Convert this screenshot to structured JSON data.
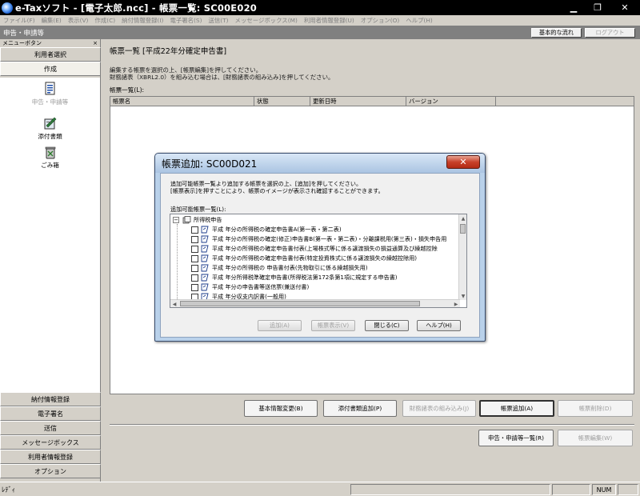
{
  "window": {
    "title": "e-Taxソフト - [電子太郎.ncc] - 帳票一覧: SC00E020",
    "minimize": "▁",
    "restore": "❐",
    "close": "✕"
  },
  "menubar": {
    "items": [
      "ファイル(F)",
      "編集(E)",
      "表示(V)",
      "作成(C)",
      "納付情報登録(I)",
      "電子署名(S)",
      "送信(T)",
      "メッセージボックス(M)",
      "利用者情報登録(U)",
      "オプション(O)",
      "ヘルプ(H)"
    ]
  },
  "section": {
    "title": "申告・申請等",
    "basic_flow_button": "基本的な流れ",
    "logout_button": "ログアウト"
  },
  "left_panel": {
    "header": "メニューボタン",
    "pin": "×",
    "user_select": "利用者選択",
    "create": "作成",
    "items": [
      {
        "label": "申告・申請等",
        "icon": "document-form-icon"
      },
      {
        "label": "添付書類",
        "icon": "attachment-icon"
      },
      {
        "label": "ごみ箱",
        "icon": "trash-icon"
      }
    ],
    "bottom_buttons": [
      "納付情報登録",
      "電子署名",
      "送信",
      "メッセージボックス",
      "利用者情報登録",
      "オプション"
    ]
  },
  "main": {
    "heading": "帳票一覧 [平成22年分確定申告書]",
    "instructions": [
      "編集する帳票を選択の上、[帳票編集]を押してください。",
      "財務諸表（XBRL2.0）を組み込む場合は、[財務諸表の組み込み]を押してください。"
    ],
    "list_label": "帳票一覧(L):",
    "columns": [
      "帳票名",
      "状態",
      "更新日時",
      "バージョン"
    ],
    "buttons": {
      "basic_info_change": "基本情報変更(B)",
      "add_attachment": "添付書類追加(P)",
      "import_financial": "財務諸表の組み込み(J)",
      "add_form": "帳票追加(A)",
      "delete_form": "帳票削除(D)",
      "declaration_list": "申告・申請等一覧(R)",
      "edit_form": "帳票編集(W)"
    }
  },
  "dialog": {
    "title": "帳票追加: SC00D021",
    "close": "✕",
    "instructions": [
      "追加可能帳票一覧より追加する帳票を選択の上、[追加]を押してください。",
      "[帳票表示]を押すことにより、帳票のイメージが表示され確認することができます。"
    ],
    "list_label": "追加可能帳票一覧(L):",
    "root": {
      "expander": "⊟",
      "label": "所得税申告"
    },
    "rows": [
      "平成  年分の所得税の確定申告書A(第一表・第二表)",
      "平成  年分の所得税の確定(修正)申告書B(第一表・第二表)・分離課税用(第三表)・損失申告用",
      "平成  年分の所得税の確定申告書付表(上場株式等に係る譲渡損失の損益通算及び繰越控除",
      "平成  年分の所得税の確定申告書付表(特定投資株式に係る譲渡損失の繰越控除用)",
      "平成  年分の所得税の    申告書付表(先物取引に係る繰越損失用)",
      "平成  年分所得税準確定申告書(所得税法第172条第1項に規定する申告書)",
      "平成  年分の申告書等送信票(兼送付書)",
      "平成  年分収支内訳書(一般用)"
    ],
    "buttons": {
      "add": "追加(A)",
      "show": "帳票表示(V)",
      "close": "閉じる(C)",
      "help": "ヘルプ(H)"
    }
  },
  "statusbar": {
    "text": "ﾚﾃﾞｨ",
    "num": "NUM"
  }
}
